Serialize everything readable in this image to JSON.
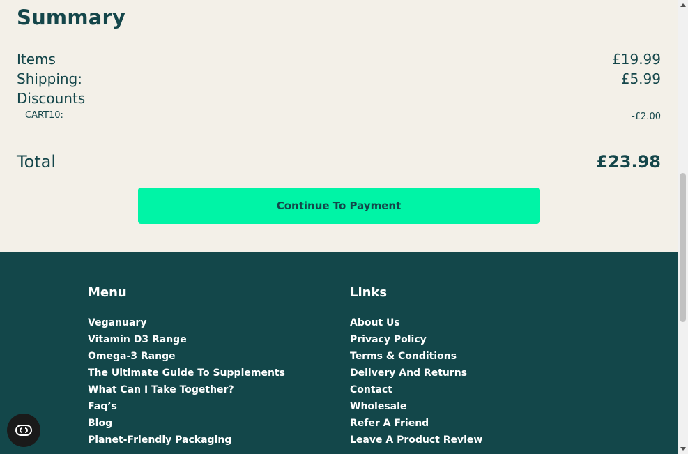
{
  "summary": {
    "title": "Summary",
    "items_label": "Items",
    "items_value": "£19.99",
    "shipping_label": "Shipping:",
    "shipping_value": "£5.99",
    "discounts_label": "Discounts",
    "discount_code": "CART10:",
    "discount_value": "-£2.00",
    "total_label": "Total",
    "total_value": "£23.98",
    "cta_label": "Continue To Payment"
  },
  "footer": {
    "menu": {
      "title": "Menu",
      "items": [
        "Veganuary",
        "Vitamin D3 Range",
        "Omega-3 Range",
        "The Ultimate Guide To Supplements",
        "What Can I Take Together?",
        "Faq’s",
        "Blog",
        "Planet-Friendly Packaging"
      ]
    },
    "links": {
      "title": "Links",
      "items": [
        "About Us",
        "Privacy Policy",
        "Terms & Conditions",
        "Delivery And Returns",
        "Contact",
        "Wholesale",
        "Refer A Friend",
        "Leave A Product Review"
      ]
    }
  },
  "chat": {
    "icon": "chat-widget-icon"
  },
  "colors": {
    "background": "#f3f0e8",
    "brand_dark": "#13474a",
    "accent": "#00f4a6"
  }
}
